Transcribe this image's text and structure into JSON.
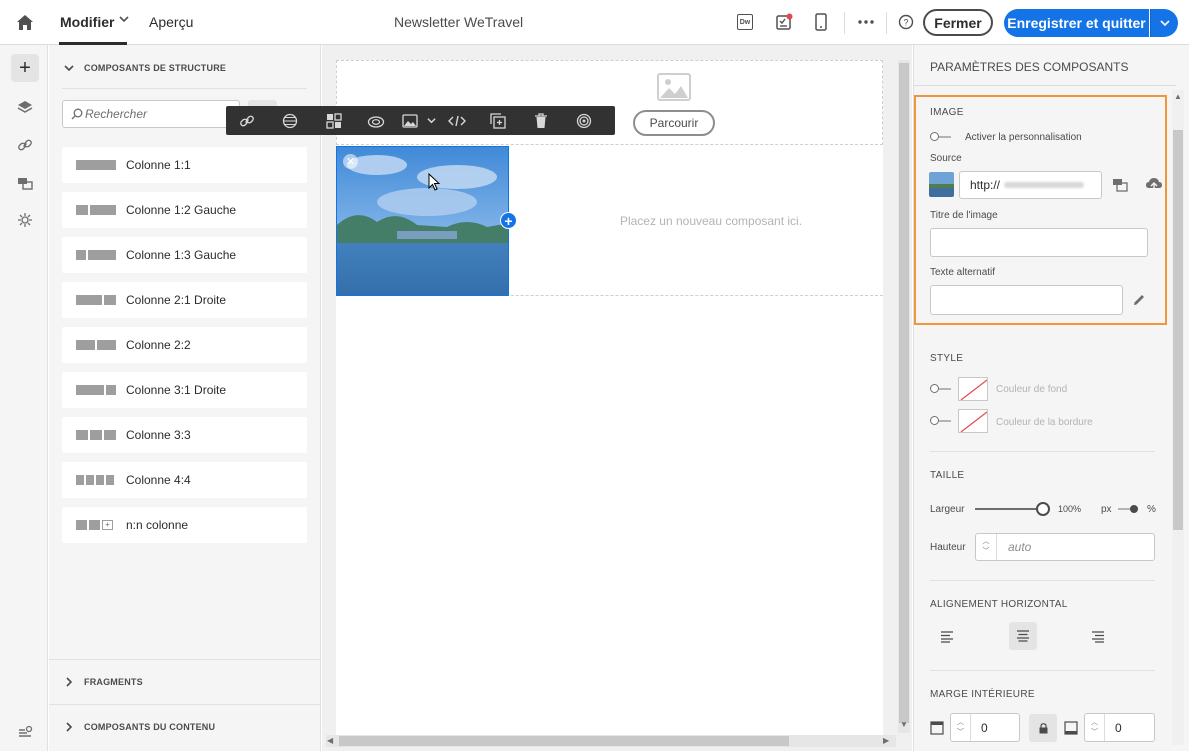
{
  "header": {
    "tab_edit": "Modifier",
    "tab_preview": "Aperçu",
    "title": "Newsletter WeTravel",
    "close_label": "Fermer",
    "save_label": "Enregistrer et quitter",
    "dw_label": "Dw"
  },
  "components": {
    "structure_title": "COMPOSANTS DE STRUCTURE",
    "search_placeholder": "Rechercher",
    "items": [
      {
        "label": "Colonne 1:1"
      },
      {
        "label": "Colonne 1:2 Gauche"
      },
      {
        "label": "Colonne 1:3 Gauche"
      },
      {
        "label": "Colonne 2:1 Droite"
      },
      {
        "label": "Colonne 2:2"
      },
      {
        "label": "Colonne 3:1 Droite"
      },
      {
        "label": "Colonne 3:3"
      },
      {
        "label": "Colonne 4:4"
      },
      {
        "label": "n:n colonne"
      }
    ],
    "fragments_title": "FRAGMENTS",
    "content_title": "COMPOSANTS DU CONTENU"
  },
  "canvas": {
    "browse_label": "Parcourir",
    "drop_hint": "Placez un nouveau composant ici."
  },
  "properties": {
    "title": "PARAMÈTRES DES COMPOSANTS",
    "image_section": "IMAGE",
    "personalization_label": "Activer la personnalisation",
    "source_label": "Source",
    "source_value": "http://",
    "image_title_label": "Titre de l'image",
    "image_title_value": "",
    "alt_label": "Texte alternatif",
    "alt_value": "",
    "style_section": "STYLE",
    "bg_color_label": "Couleur de fond",
    "border_color_label": "Couleur de la bordure",
    "size_section": "TAILLE",
    "width_label": "Largeur",
    "width_value": "100%",
    "width_percent": 100,
    "unit_px": "px",
    "unit_percent": "%",
    "height_label": "Hauteur",
    "height_placeholder": "auto",
    "align_section": "ALIGNEMENT HORIZONTAL",
    "padding_section": "MARGE INTÉRIEURE",
    "padding_top_value": "0",
    "padding_bottom_value": "0"
  },
  "colors": {
    "accent": "#1473e6",
    "highlight_border": "#f0963c",
    "toolbar_bg": "#323232"
  }
}
